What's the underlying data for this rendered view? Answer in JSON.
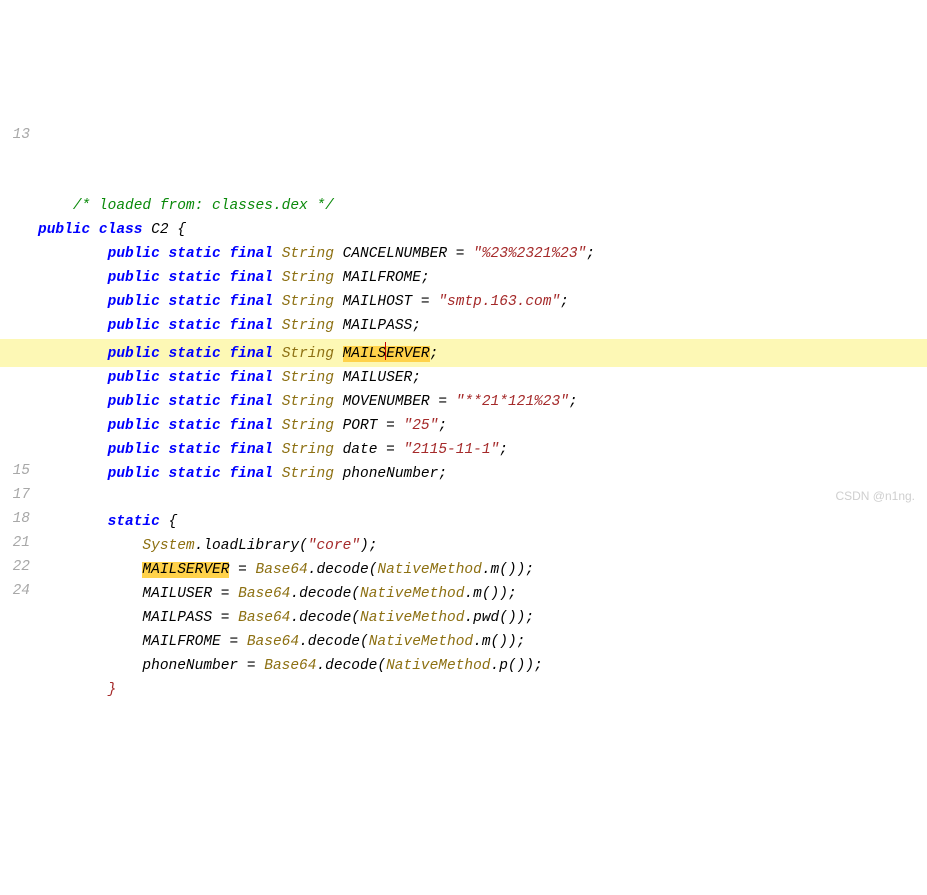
{
  "gutter": {
    "l1": "",
    "l2": "13",
    "l3": "",
    "l4": "",
    "l5": "",
    "l6": "",
    "l7": "",
    "l8": "",
    "l9": "",
    "l10": "",
    "l11": "",
    "l12": "",
    "l13": "",
    "l14": "",
    "l15": "",
    "l16": "15",
    "l17": "17",
    "l18": "18",
    "l19": "21",
    "l20": "22",
    "l21": "24",
    "l22": ""
  },
  "code": {
    "comment": "/* loaded from: classes.dex */",
    "kw_public": "public",
    "kw_static": "static",
    "kw_final": "final",
    "kw_class": "class",
    "type_String": "String",
    "class_name": "C2",
    "fields": {
      "CANCELNUMBER": "CANCELNUMBER",
      "MAILFROME": "MAILFROME",
      "MAILHOST": "MAILHOST",
      "MAILPASS": "MAILPASS",
      "MAILSERVER_pre": "MAILS",
      "MAILSERVER_post": "RVER",
      "MAILSERVER_full": "MAILSERVER",
      "MAILUSER": "MAILUSER",
      "MOVENUMBER": "MOVENUMBER",
      "PORT": "PORT",
      "date": "date",
      "phoneNumber": "phoneNumber"
    },
    "values": {
      "CANCELNUMBER": "\"%23%2321%23\"",
      "MAILHOST": "\"smtp.163.com\"",
      "MOVENUMBER": "\"**21*121%23\"",
      "PORT": "\"25\"",
      "date": "\"2115-11-1\"",
      "core": "\"core\""
    },
    "calls": {
      "System": "System",
      "loadLibrary": "loadLibrary",
      "Base64": "Base64",
      "decode": "decode",
      "NativeMethod": "NativeMethod",
      "m": "m",
      "pwd": "pwd",
      "p": "p"
    },
    "punct": {
      "eq": " = ",
      "semi": ";",
      "dot": ".",
      "lpar": "(",
      "rpar": ")",
      "lbr": " {",
      "rbr": "}",
      "indent1": "    ",
      "indent2": "        ",
      "indent3": "            ",
      "E_char": "E"
    }
  },
  "watermark": "CSDN @n1ng."
}
